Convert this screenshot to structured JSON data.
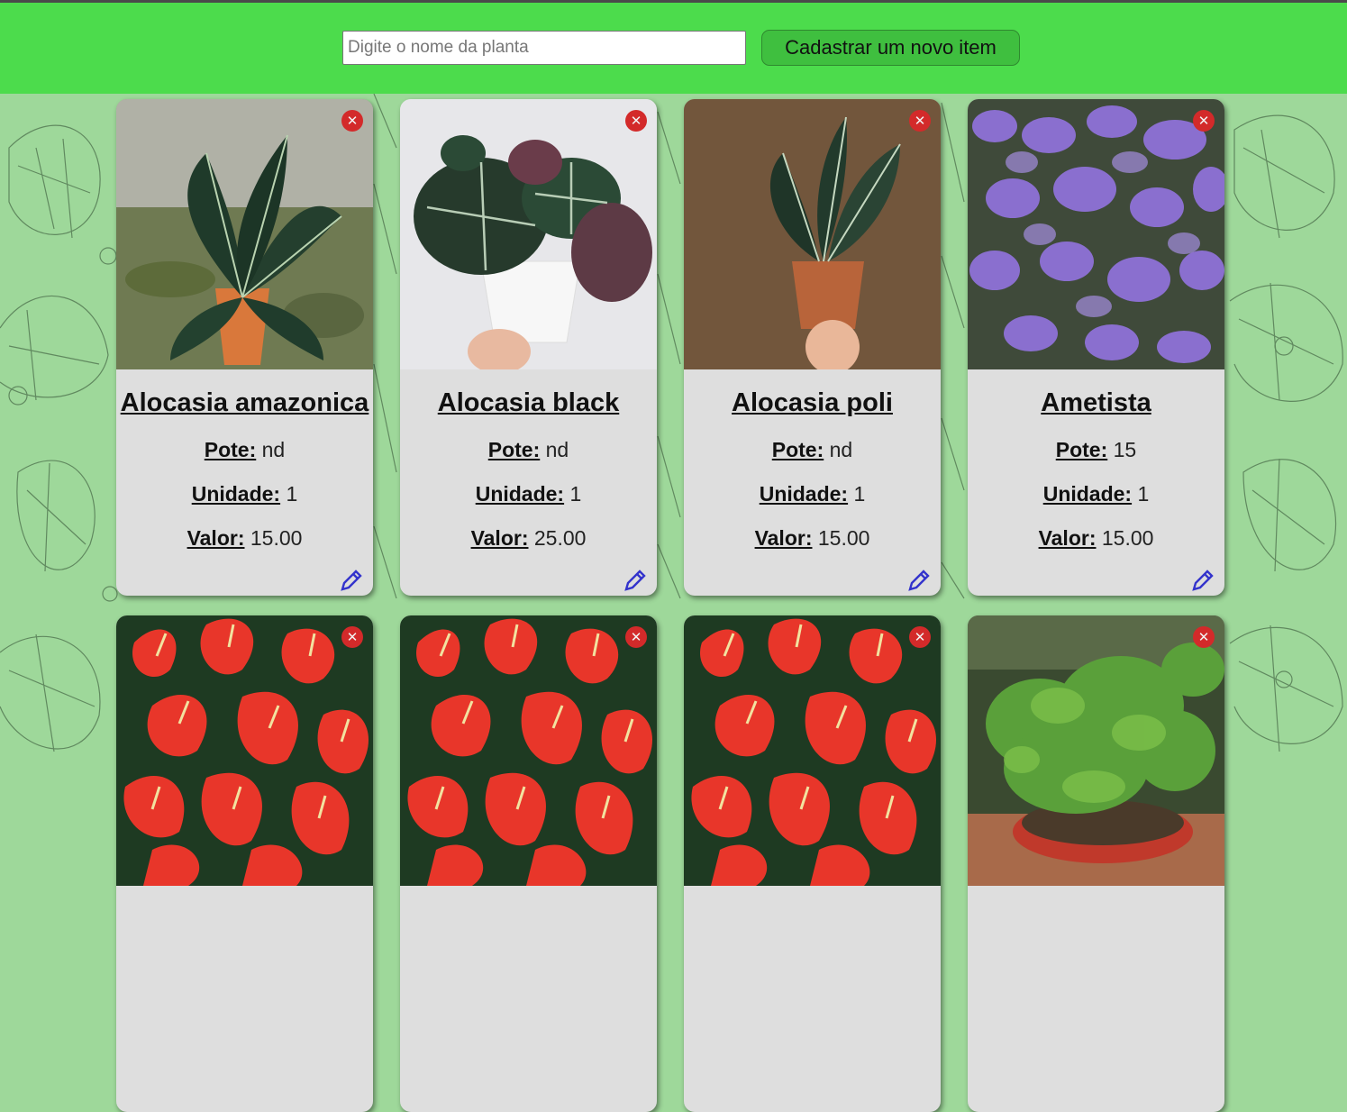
{
  "header": {
    "search_placeholder": "Digite o nome da planta",
    "new_item_label": "Cadastrar um novo item"
  },
  "labels": {
    "pote": "Pote:",
    "unidade": "Unidade:",
    "valor": "Valor:"
  },
  "icons": {
    "delete": "close-circle-icon",
    "edit": "pencil-icon"
  },
  "colors": {
    "header": "#4cdc4c",
    "delete": "#d32a2a",
    "edit": "#3333cc",
    "card": "#dedede"
  },
  "cards": [
    {
      "name": "Alocasia amazonica",
      "pote": "nd",
      "unidade": "1",
      "valor": "15.00"
    },
    {
      "name": "Alocasia black",
      "pote": "nd",
      "unidade": "1",
      "valor": "25.00"
    },
    {
      "name": "Alocasia poli",
      "pote": "nd",
      "unidade": "1",
      "valor": "15.00"
    },
    {
      "name": "Ametista",
      "pote": "15",
      "unidade": "1",
      "valor": "15.00"
    },
    {
      "name": "",
      "pote": "",
      "unidade": "",
      "valor": ""
    },
    {
      "name": "",
      "pote": "",
      "unidade": "",
      "valor": ""
    },
    {
      "name": "",
      "pote": "",
      "unidade": "",
      "valor": ""
    },
    {
      "name": "",
      "pote": "",
      "unidade": "",
      "valor": ""
    }
  ]
}
